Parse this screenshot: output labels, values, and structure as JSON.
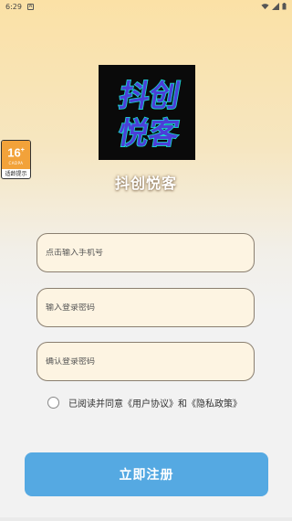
{
  "status_bar": {
    "time": "6:29",
    "notification_icon": "notification-box-icon",
    "wifi_icon": "wifi-icon",
    "signal_icon": "signal-icon",
    "battery_icon": "battery-icon"
  },
  "logo": {
    "line1": "抖创",
    "line2": "悦客",
    "colors": {
      "fill": "#4b3fd8",
      "outline": "#18e0d0",
      "background": "#0a0a0a"
    }
  },
  "app_name": "抖创悦客",
  "age_badge": {
    "number": "16",
    "plus": "+",
    "sub": "CADPA",
    "label": "适龄提示"
  },
  "form": {
    "phone_placeholder": "点击输入手机号",
    "password_placeholder": "输入登录密码",
    "confirm_placeholder": "确认登录密码"
  },
  "agreement": {
    "text": "已阅读并同意《用户协议》和《隐私政策》"
  },
  "register_button": "立即注册",
  "colors": {
    "accent": "#55a9e2",
    "field_bg": "#fdf4e2",
    "badge_orange": "#f2a23a"
  }
}
